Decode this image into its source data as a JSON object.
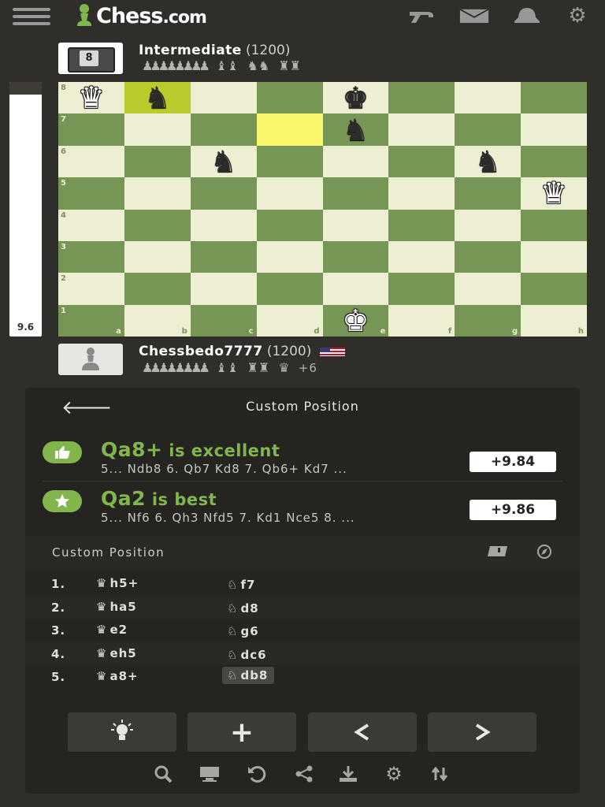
{
  "app": {
    "logo_main": "Chess",
    "logo_domain": ".com",
    "icons": [
      "menu-icon",
      "puzzle-icon",
      "mail-icon",
      "bell-icon",
      "gear-icon"
    ]
  },
  "opponent": {
    "name": "Intermediate",
    "rating": "(1200)",
    "avatar_label": "8",
    "captured_pawns": "♟♟♟♟♟♟♟♟",
    "captured_pieces": [
      "♝♝",
      "♞♞",
      "♜♜"
    ]
  },
  "player": {
    "name": "Chessbedo7777",
    "rating": "(1200)",
    "flag": "us-flag",
    "captured_pawns": "♟♟♟♟♟♟♟♟",
    "captured_pieces": [
      "♝♝",
      "♜♜",
      "♛"
    ],
    "material": "+6"
  },
  "eval_bar": {
    "score": "9.6",
    "white_fraction": 0.95
  },
  "board": {
    "files": [
      "a",
      "b",
      "c",
      "d",
      "e",
      "f",
      "g",
      "h"
    ],
    "ranks": [
      "8",
      "7",
      "6",
      "5",
      "4",
      "3",
      "2",
      "1"
    ],
    "highlight": [
      "b8",
      "d7"
    ],
    "pieces": [
      {
        "square": "a8",
        "glyph": "♛",
        "color": "w"
      },
      {
        "square": "b8",
        "glyph": "♞",
        "color": "b"
      },
      {
        "square": "e8",
        "glyph": "♚",
        "color": "b"
      },
      {
        "square": "e7",
        "glyph": "♞",
        "color": "b"
      },
      {
        "square": "c6",
        "glyph": "♞",
        "color": "b"
      },
      {
        "square": "g6",
        "glyph": "♞",
        "color": "b"
      },
      {
        "square": "h5",
        "glyph": "♛",
        "color": "w"
      },
      {
        "square": "e1",
        "glyph": "♚",
        "color": "w"
      }
    ]
  },
  "analysis": {
    "title": "Custom Position",
    "lines": [
      {
        "move": "Qa8+",
        "verdict": "is excellent",
        "continuation": "5... Ndb8 6. Qb7 Kd8 7. Qb6+ Kd7 ...",
        "score": "+9.84",
        "icon": "thumbs-up-icon"
      },
      {
        "move": "Qa2",
        "verdict": "is best",
        "continuation": "5... Nf6 6. Qh3 Nfd5 7. Kd1 Nce5 8. ...",
        "score": "+9.86",
        "icon": "star-icon"
      }
    ]
  },
  "moves": {
    "title": "Custom Position",
    "rows": [
      {
        "num": "1.",
        "white": "h5+",
        "black": "f7"
      },
      {
        "num": "2.",
        "white": "ha5",
        "black": "d8"
      },
      {
        "num": "3.",
        "white": "e2",
        "black": "g6"
      },
      {
        "num": "4.",
        "white": "eh5",
        "black": "dc6"
      },
      {
        "num": "5.",
        "white": "a8+",
        "black": "db8"
      }
    ],
    "white_piece_glyph": "♛",
    "black_piece_glyph": "♘",
    "active_row": 4
  },
  "controls": {
    "buttons": [
      "hint",
      "add",
      "previous",
      "next"
    ],
    "tools": [
      "analysis-icon",
      "computer-icon",
      "undo-icon",
      "share-icon",
      "download-icon",
      "settings-icon",
      "flip-icon"
    ]
  }
}
